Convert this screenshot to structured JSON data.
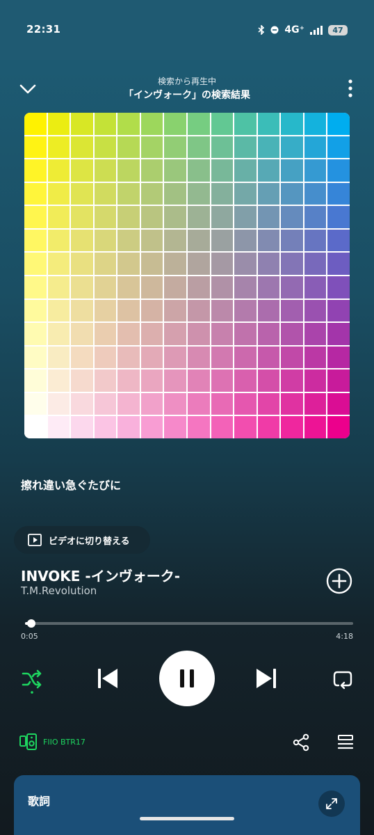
{
  "status": {
    "time": "22:31",
    "network": "4G⁺",
    "battery": "47"
  },
  "header": {
    "context": "検索から再生中",
    "title": "「インヴォーク」の検索結果"
  },
  "artwork": {
    "colors": {
      "top_left": "#fff200",
      "top_right": "#00adef",
      "bottom_left": "#ffffff",
      "bottom_right": "#ec008c"
    }
  },
  "lyric_line": "擦れ違い急ぐたびに",
  "video_toggle": {
    "label": "ビデオに切り替える"
  },
  "track": {
    "title": "INVOKE -インヴォーク-",
    "artist": "T.M.Revolution"
  },
  "progress": {
    "elapsed": "0:05",
    "total": "4:18",
    "fraction": 0.02
  },
  "device": {
    "name": "FIIO BTR17",
    "color": "#1ed760"
  },
  "lyrics_card": {
    "label": "歌詞"
  },
  "colors": {
    "accent": "#1ed760",
    "background_top": "#1f5a72",
    "background_bottom": "#121a1f"
  }
}
